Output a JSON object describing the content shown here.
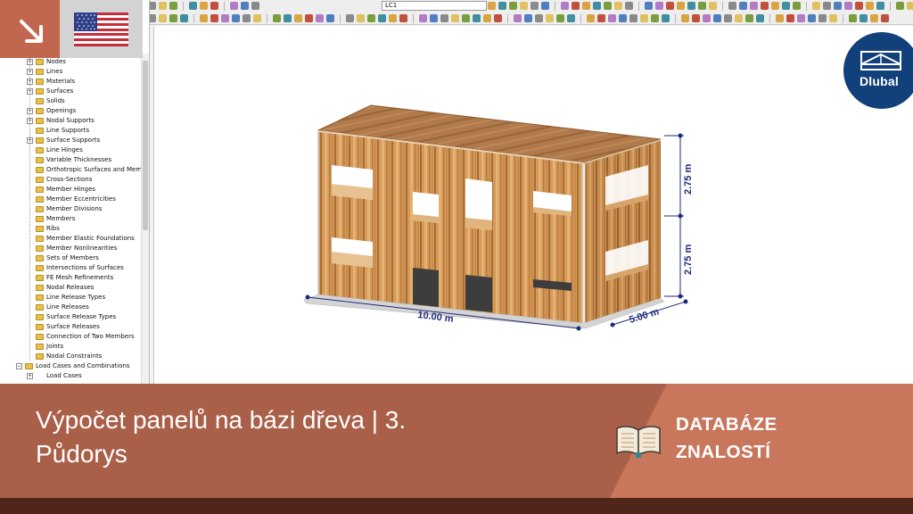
{
  "toolbar": {
    "load_case_select": "LC1"
  },
  "navigator": {
    "items": [
      {
        "label": "Nodes",
        "expandable": true
      },
      {
        "label": "Lines",
        "expandable": true
      },
      {
        "label": "Materials",
        "expandable": true
      },
      {
        "label": "Surfaces",
        "expandable": true
      },
      {
        "label": "Solids",
        "expandable": false
      },
      {
        "label": "Openings",
        "expandable": true
      },
      {
        "label": "Nodal Supports",
        "expandable": true
      },
      {
        "label": "Line Supports",
        "expandable": false
      },
      {
        "label": "Surface Supports",
        "expandable": true
      },
      {
        "label": "Line Hinges",
        "expandable": false
      },
      {
        "label": "Variable Thicknesses",
        "expandable": false
      },
      {
        "label": "Orthotropic Surfaces and Memb",
        "expandable": false
      },
      {
        "label": "Cross-Sections",
        "expandable": false
      },
      {
        "label": "Member Hinges",
        "expandable": false
      },
      {
        "label": "Member Eccentricities",
        "expandable": false
      },
      {
        "label": "Member Divisions",
        "expandable": false
      },
      {
        "label": "Members",
        "expandable": false
      },
      {
        "label": "Ribs",
        "expandable": false
      },
      {
        "label": "Member Elastic Foundations",
        "expandable": false
      },
      {
        "label": "Member Nonlinearities",
        "expandable": false
      },
      {
        "label": "Sets of Members",
        "expandable": false
      },
      {
        "label": "Intersections of Surfaces",
        "expandable": false
      },
      {
        "label": "FE Mesh Refinements",
        "expandable": false
      },
      {
        "label": "Nodal Releases",
        "expandable": false
      },
      {
        "label": "Line Release Types",
        "expandable": false
      },
      {
        "label": "Line Releases",
        "expandable": false
      },
      {
        "label": "Surface Release Types",
        "expandable": false
      },
      {
        "label": "Surface Releases",
        "expandable": false
      },
      {
        "label": "Connection of Two Members",
        "expandable": false
      },
      {
        "label": "Joints",
        "expandable": false
      },
      {
        "label": "Nodal Constraints",
        "expandable": false
      }
    ],
    "load_cases_group": "Load Cases and Combinations",
    "load_cases_item": "Load Cases"
  },
  "model": {
    "dim_length": "10.00 m",
    "dim_width": "5.00 m",
    "dim_height_upper": "2.75 m",
    "dim_height_lower": "2.75 m"
  },
  "logo": {
    "text": "Dlubal"
  },
  "banner": {
    "title_line1": "Výpočet panelů na bázi dřeva | 3.",
    "title_line2": "Půdorys",
    "kb_line1": "DATABÁZE",
    "kb_line2": "ZNALOSTÍ"
  },
  "colors": {
    "banner_left": "#a95f48",
    "banner_right": "#c8765c",
    "corner_arrow": "#c2674f",
    "bottom_strip": "#50261b",
    "logo": "#12407a",
    "dimension": "#1d2a7a"
  },
  "icons": {
    "corner": "arrow-down-right-icon",
    "flag": "us-flag-icon",
    "knowledge_base": "open-book-icon"
  }
}
